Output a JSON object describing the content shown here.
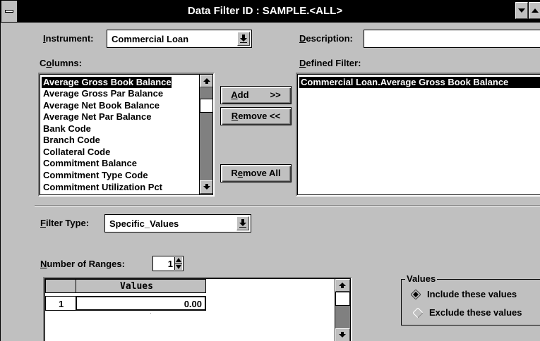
{
  "window": {
    "title": "Data Filter ID : SAMPLE.<ALL>"
  },
  "instrument": {
    "label_pre": "",
    "label_u": "I",
    "label_post": "nstrument:",
    "value": "Commercial Loan"
  },
  "description": {
    "label_u": "D",
    "label_post": "escription:",
    "value": ""
  },
  "columns": {
    "label_pre": "C",
    "label_u": "o",
    "label_post": "lumns:",
    "items": [
      "Average Gross Book Balance",
      "Average Gross Par Balance",
      "Average Net Book Balance",
      "Average Net Par Balance",
      "Bank Code",
      "Branch Code",
      "Collateral Code",
      "Commitment Balance",
      "Commitment Type Code",
      "Commitment Utilization Pct"
    ],
    "selected_index": 0
  },
  "defined_filter": {
    "label_u": "D",
    "label_post": "efined Filter:",
    "items": [
      "Commercial Loan.Average Gross Book Balance"
    ]
  },
  "buttons": {
    "add_u": "A",
    "add_post": "dd",
    "add_arrows": ">>",
    "remove_u": "R",
    "remove_post": "emove <<",
    "remove_all_pre": "R",
    "remove_all_u": "e",
    "remove_all_post": "move All"
  },
  "filter_type": {
    "label_u": "F",
    "label_post": "ilter Type:",
    "value": "Specific_Values"
  },
  "ranges": {
    "label_u": "N",
    "label_post": "umber of Ranges:",
    "value": "1"
  },
  "values_grid": {
    "header": "Values",
    "rows": [
      {
        "index": "1",
        "value": "0.00"
      }
    ]
  },
  "values_group": {
    "legend": "Values",
    "options": [
      {
        "label": "Include these values",
        "selected": true
      },
      {
        "label": "Exclude these values",
        "selected": false
      }
    ]
  }
}
